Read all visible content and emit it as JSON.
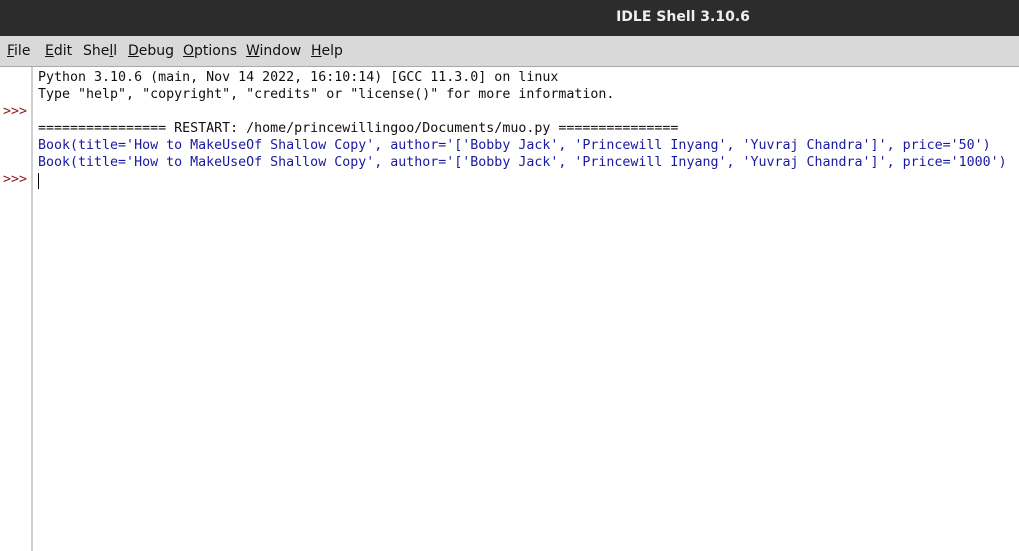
{
  "window": {
    "title": "IDLE Shell 3.10.6"
  },
  "menu": [
    {
      "pre": "",
      "u": "F",
      "post": "ile"
    },
    {
      "pre": "",
      "u": "E",
      "post": "dit"
    },
    {
      "pre": "She",
      "u": "l",
      "post": "l"
    },
    {
      "pre": "",
      "u": "D",
      "post": "ebug"
    },
    {
      "pre": "",
      "u": "O",
      "post": "ptions"
    },
    {
      "pre": "",
      "u": "W",
      "post": "indow"
    },
    {
      "pre": "",
      "u": "H",
      "post": "elp"
    }
  ],
  "shell": {
    "prompt": ">>>",
    "lines": [
      "Python 3.10.6 (main, Nov 14 2022, 16:10:14) [GCC 11.3.0] on linux",
      "Type \"help\", \"copyright\", \"credits\" or \"license()\" for more information.",
      "================ RESTART: /home/princewillingoo/Documents/muo.py ===============",
      "Book(title='How to MakeUseOf Shallow Copy', author='['Bobby Jack', 'Princewill Inyang', 'Yuvraj Chandra']', price='50')",
      "Book(title='How to MakeUseOf Shallow Copy', author='['Bobby Jack', 'Princewill Inyang', 'Yuvraj Chandra']', price='1000')"
    ]
  }
}
